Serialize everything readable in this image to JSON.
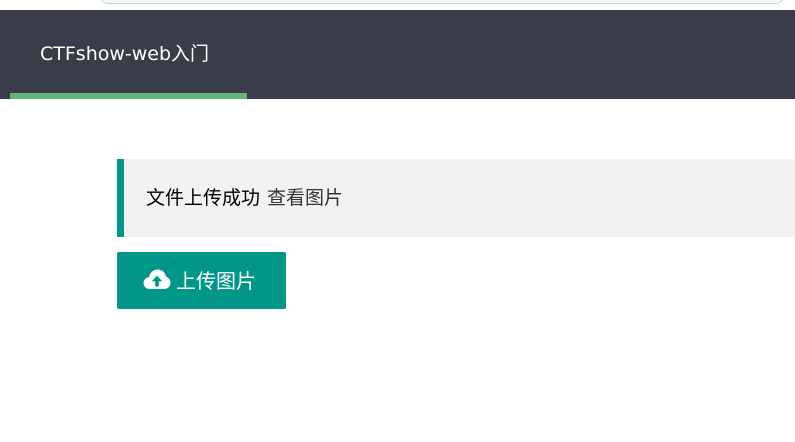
{
  "navbar": {
    "title": "CTFshow-web入门"
  },
  "result": {
    "status_text": "文件上传成功",
    "view_link": "查看图片"
  },
  "upload": {
    "button_label": "上传图片",
    "icon": "cloud-upload-icon"
  },
  "colors": {
    "navbar_bg": "#393d49",
    "nav_active": "#5fb878",
    "accent": "#009688",
    "quote_bg": "#f2f2f2"
  }
}
